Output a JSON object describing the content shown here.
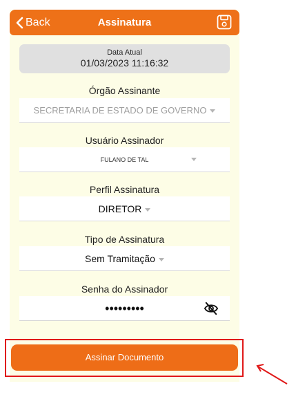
{
  "navbar": {
    "back_label": "Back",
    "title": "Assinatura"
  },
  "date": {
    "label": "Data Atual",
    "value": "01/03/2023 11:16:32"
  },
  "orgao": {
    "label": "Órgão Assinante",
    "value": "SECRETARIA DE ESTADO DE GOVERNO"
  },
  "usuario": {
    "label": "Usuário Assinador",
    "value": "FULANO DE TAL"
  },
  "perfil": {
    "label": "Perfil Assinatura",
    "value": "DIRETOR"
  },
  "tipo": {
    "label": "Tipo de Assinatura",
    "value": "Sem Tramitação"
  },
  "senha": {
    "label": "Senha do Assinador",
    "masked_value": "•••••••••"
  },
  "submit": {
    "label": "Assinar Documento"
  },
  "colors": {
    "accent": "#ee7118",
    "screen_background": "#fdfde6",
    "annotation": "#e01818"
  },
  "icons": {
    "back": "chevron-left-icon",
    "save": "floppy-disk-icon",
    "toggle_password": "eye-slash-icon",
    "dropdown": "caret-down-icon"
  }
}
